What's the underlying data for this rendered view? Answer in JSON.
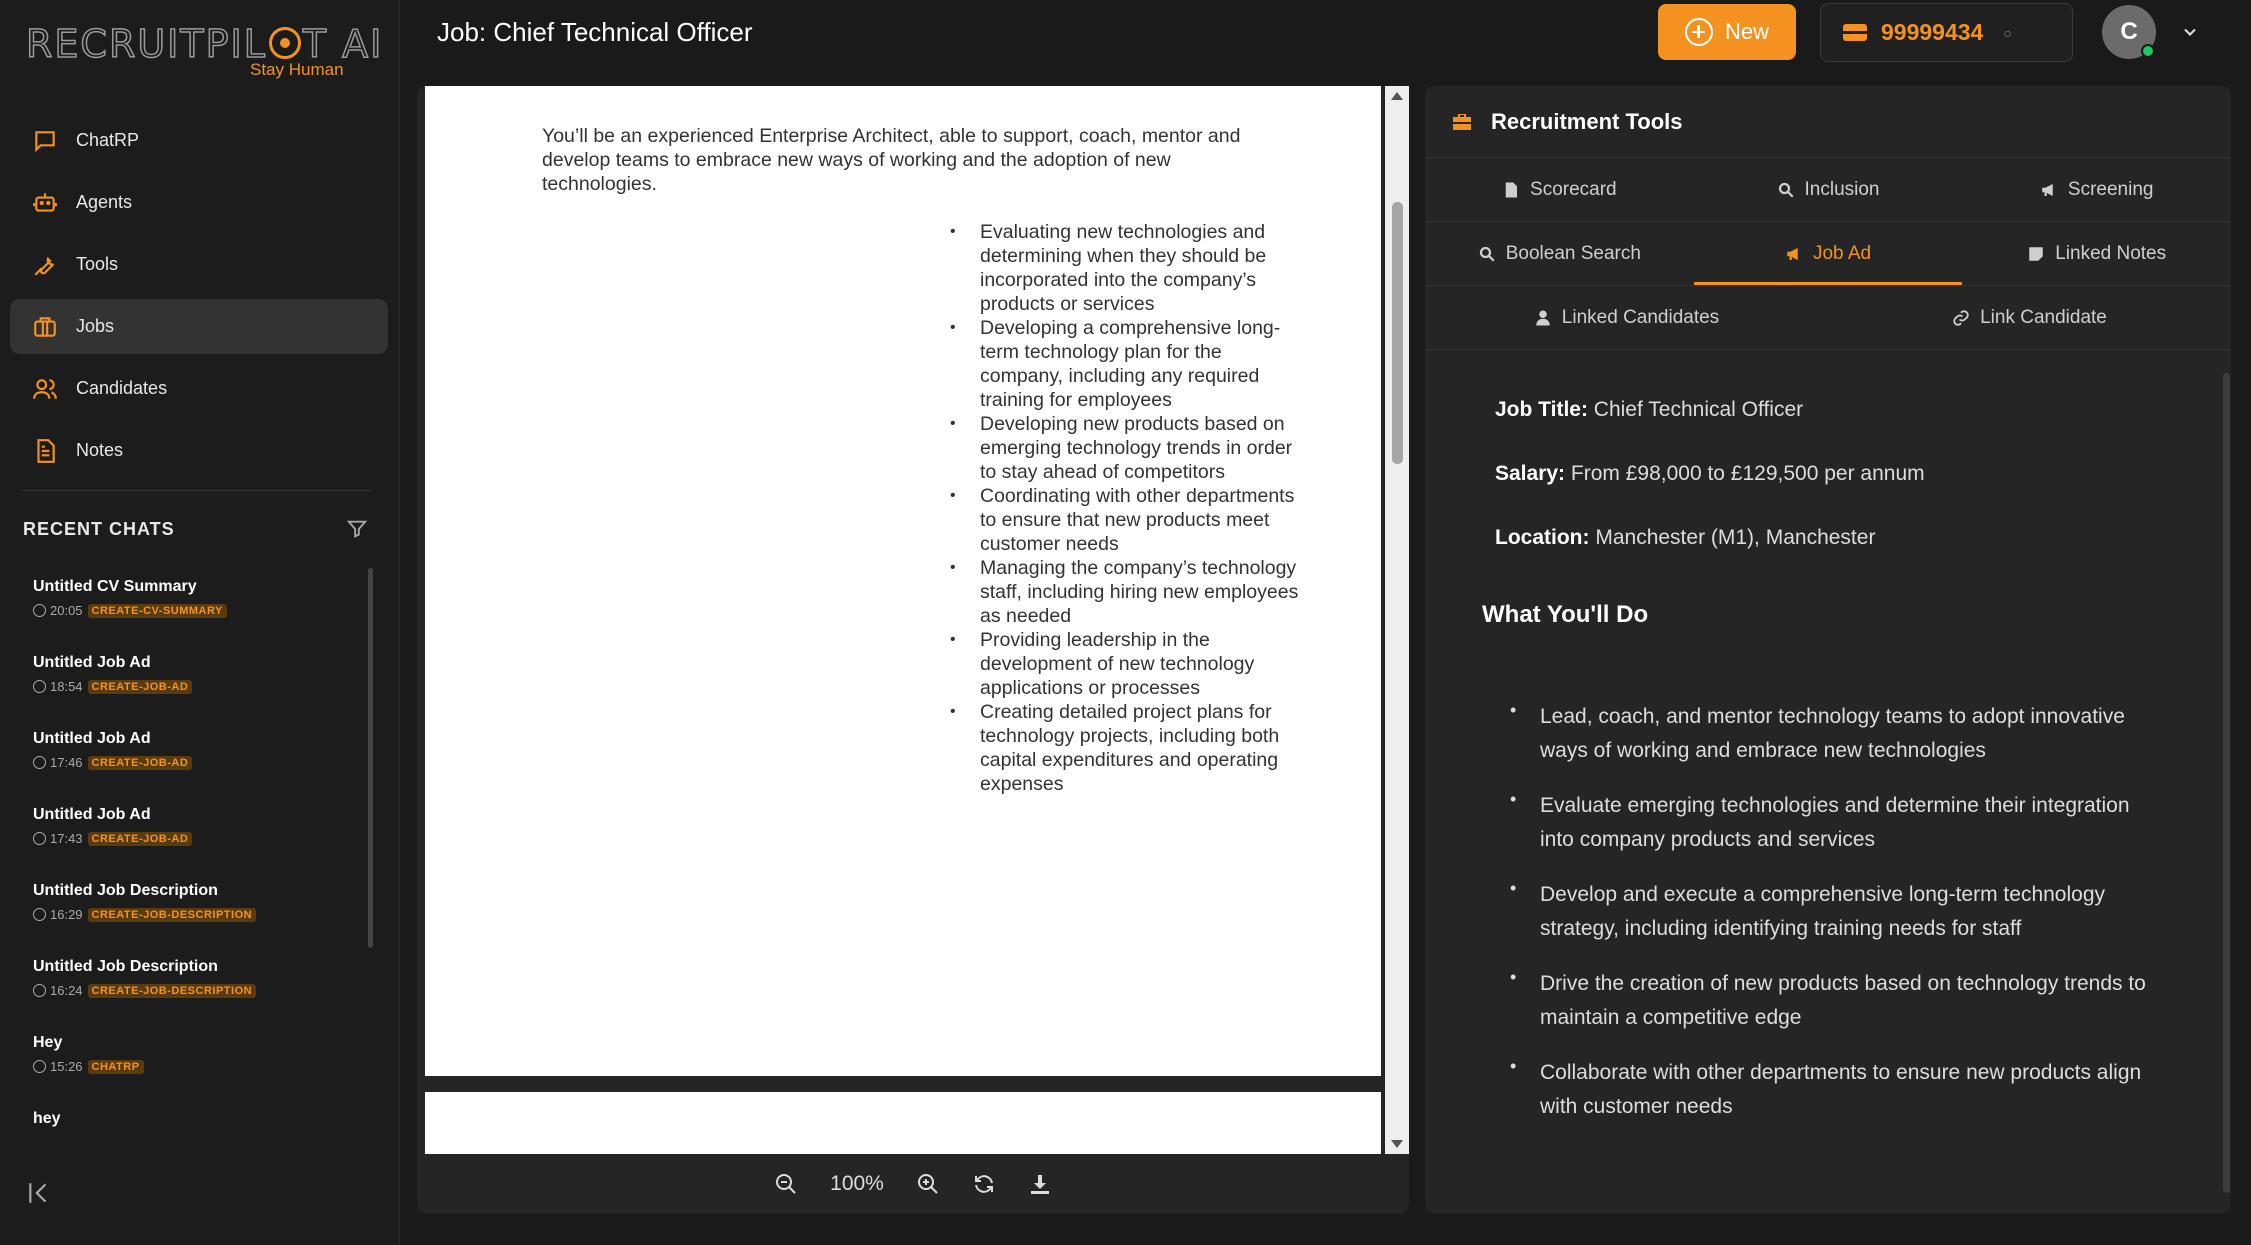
{
  "brand": {
    "name": "RECRUITPILOT AI",
    "tagline": "Stay Human"
  },
  "nav": [
    {
      "label": "ChatRP",
      "icon": "chat-icon"
    },
    {
      "label": "Agents",
      "icon": "robot-icon"
    },
    {
      "label": "Tools",
      "icon": "wrench-icon"
    },
    {
      "label": "Jobs",
      "icon": "briefcase-icon",
      "active": true
    },
    {
      "label": "Candidates",
      "icon": "users-icon"
    },
    {
      "label": "Notes",
      "icon": "document-icon"
    }
  ],
  "recent": {
    "title": "RECENT CHATS",
    "chats": [
      {
        "title": "Untitled CV Summary",
        "time": "20:05",
        "tag": "CREATE-CV-SUMMARY"
      },
      {
        "title": "Untitled Job Ad",
        "time": "18:54",
        "tag": "CREATE-JOB-AD"
      },
      {
        "title": "Untitled Job Ad",
        "time": "17:46",
        "tag": "CREATE-JOB-AD"
      },
      {
        "title": "Untitled Job Ad",
        "time": "17:43",
        "tag": "CREATE-JOB-AD"
      },
      {
        "title": "Untitled Job Description",
        "time": "16:29",
        "tag": "CREATE-JOB-DESCRIPTION"
      },
      {
        "title": "Untitled Job Description",
        "time": "16:24",
        "tag": "CREATE-JOB-DESCRIPTION"
      },
      {
        "title": "Hey",
        "time": "15:26",
        "tag": "CHATRP"
      },
      {
        "title": "hey",
        "time": "",
        "tag": ""
      }
    ]
  },
  "header": {
    "title": "Job: Chief Technical Officer",
    "new_label": "New",
    "credits": "99999434",
    "avatar_initial": "C"
  },
  "document": {
    "intro": "You’ll be an experienced Enterprise Architect, able to support, coach, mentor and develop teams to embrace new ways of working and the adoption of new technologies.",
    "bullets": [
      "Evaluating new technologies and determining when they should be incorporated into the company’s products or services",
      "Developing a comprehensive long-term technology plan for the company, including any required training for employees",
      "Developing new products based on emerging technology trends in order to stay ahead of competitors",
      "Coordinating with other departments to ensure that new products meet customer needs",
      "Managing the company’s technology staff, including hiring new employees as needed",
      "Providing leadership in the development of new technology applications or processes",
      "Creating detailed project plans for technology projects, including both capital expenditures and operating expenses"
    ],
    "zoom": "100%"
  },
  "tools": {
    "title": "Recruitment Tools",
    "tabs_row1": [
      "Scorecard",
      "Inclusion",
      "Screening"
    ],
    "tabs_row2": [
      "Boolean Search",
      "Job Ad",
      "Linked Notes"
    ],
    "tabs_row3": [
      "Linked Candidates",
      "Link Candidate"
    ],
    "active_tab": "Job Ad",
    "job_title_label": "Job Title:",
    "job_title": "Chief Technical Officer",
    "salary_label": "Salary:",
    "salary": "From £98,000 to £129,500 per annum",
    "location_label": "Location:",
    "location": "Manchester (M1), Manchester",
    "section": "What You'll Do",
    "bullets": [
      "Lead, coach, and mentor technology teams to adopt innovative ways of working and embrace new technologies",
      "Evaluate emerging technologies and determine their integration into company products and services",
      "Develop and execute a comprehensive long-term technology strategy, including identifying training needs for staff",
      "Drive the creation of new products based on technology trends to maintain a competitive edge",
      "Collaborate with other departments to ensure new products align with customer needs"
    ]
  },
  "colors": {
    "accent": "#f39220",
    "background": "#1a1a1a",
    "panel": "#252525"
  }
}
